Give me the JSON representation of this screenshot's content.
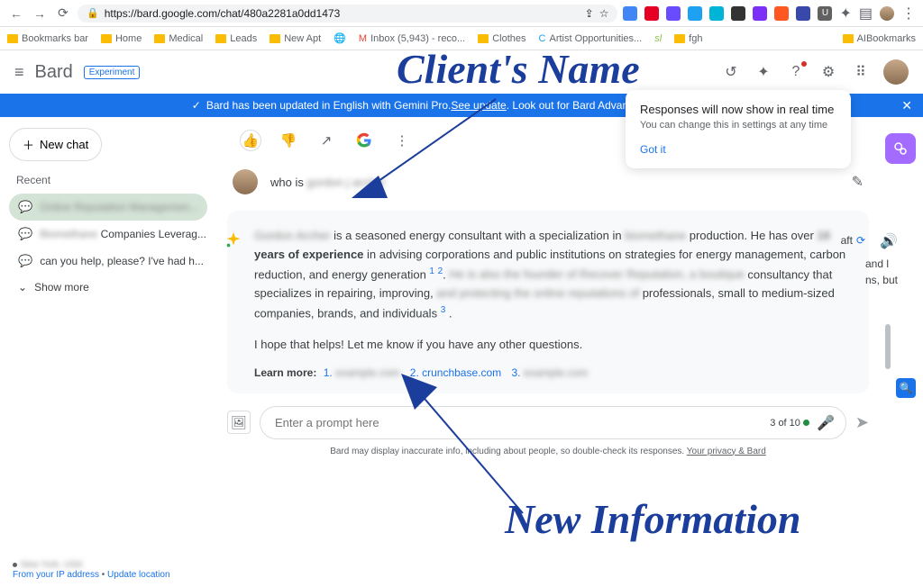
{
  "browser": {
    "url": "https://bard.google.com/chat/480a2281a0dd1473",
    "nav": {
      "back": "←",
      "forward": "→",
      "reload": "⟳"
    }
  },
  "bookmarks": {
    "items": [
      "Bookmarks bar",
      "Home",
      "Medical",
      "Leads",
      "New Apt"
    ],
    "inbox": "Inbox (5,943) - reco...",
    "more": [
      "Clothes",
      "Artist Opportunities...",
      "fgh"
    ],
    "right": "AIBookmarks"
  },
  "header": {
    "brand": "Bard",
    "badge": "Experiment"
  },
  "banner": {
    "text_pre": "Bard has been updated in English with Gemini Pro. ",
    "link": "See update",
    "text_post": ". Look out for Bard Advanced with Gemini Ultra"
  },
  "sidebar": {
    "new_chat": "New chat",
    "recent_label": "Recent",
    "items": [
      {
        "label": "Online Reputation Managemen...",
        "blur": true
      },
      {
        "label_pre": "Biomethane ",
        "label": "Companies Leverag..."
      },
      {
        "label": "can you help, please? I've had h..."
      }
    ],
    "show_more": "Show more",
    "footer_loc": "New York, USA",
    "footer_ip": "From your IP address",
    "footer_update": "Update location"
  },
  "chat": {
    "query_pre": "who is ",
    "query_blur": "gordon j archer",
    "response": {
      "p1_blur1": "Gordon Archer ",
      "p1a": "is a seasoned energy consultant with a specialization in ",
      "p1_blur2": "biomethane",
      "p1b": " production. He has over ",
      "years_blur": "18",
      "p1c": " years of experience",
      "p1d": " in advising corporations and public institutions on strategies for energy management, carbon reduction, and energy generation ",
      "p1e": ". ",
      "p1_blur3": "He is also the founder of Recover Reputation, a boutique",
      "p1f": " consultancy that specializes in repairing, improving, ",
      "p1_blur4": "and protecting the online reputations of",
      "p1g": " professionals, small to medium-sized companies, brands, and individuals ",
      "followup": "I hope that helps! Let me know if you have any other questions.",
      "learn_label": "Learn more:",
      "learn_1": "1. ",
      "src1_blur": "example.com",
      "learn_2": "2. crunchbase.com",
      "learn_3": "3. ",
      "src3_blur": "example.com"
    },
    "draft_label": "aft",
    "peek1": "and l",
    "peek2": "ns, but"
  },
  "prompt": {
    "placeholder": "Enter a prompt here",
    "counter": "3 of 10"
  },
  "disclaimer": {
    "text": "Bard may display inaccurate info, including about people, so double-check its responses. ",
    "link": "Your privacy & Bard"
  },
  "popup": {
    "title": "Responses will now show in real time",
    "body": "You can change this in settings at any time",
    "action": "Got it"
  },
  "annotations": {
    "a1": "Client's Name",
    "a2": "New Information"
  }
}
